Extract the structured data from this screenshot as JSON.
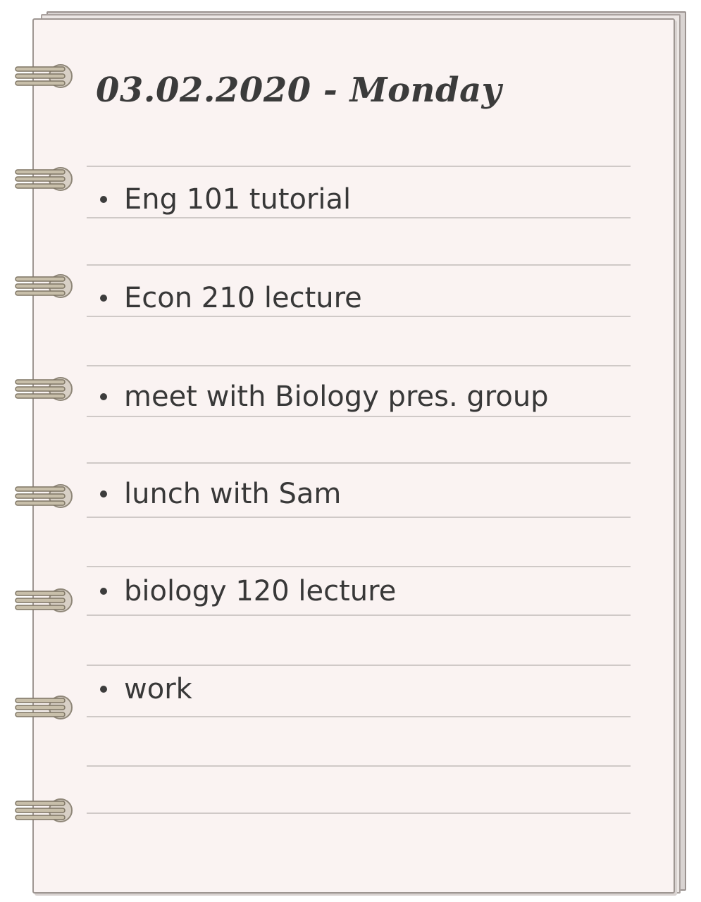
{
  "notebook": {
    "title": "03.02.2020 - Monday",
    "entries": [
      {
        "text": "Eng 101 tutorial"
      },
      {
        "text": "Econ 210 lecture"
      },
      {
        "text": "meet with Biology pres. group"
      },
      {
        "text": "lunch with Sam"
      },
      {
        "text": "biology 120 lecture"
      },
      {
        "text": "work"
      }
    ],
    "binding_icon": "spiral-ring-icon"
  },
  "colors": {
    "paper": "#faf3f2",
    "ink": "#383838",
    "ruling": "#cfc9c7",
    "ring": "#c8bfaa"
  }
}
